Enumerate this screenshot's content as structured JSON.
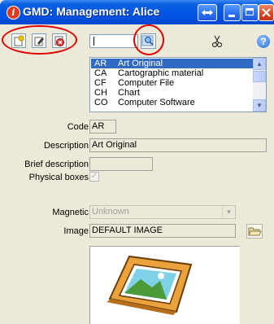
{
  "window": {
    "title": "GMD: Management: Alice",
    "title_icon": "info-icon"
  },
  "toolbar": {
    "search_value": "",
    "help_label": "?"
  },
  "code_list": {
    "items": [
      {
        "code": "AR",
        "description": "Art Original",
        "selected": true
      },
      {
        "code": "CA",
        "description": "Cartographic material",
        "selected": false
      },
      {
        "code": "CF",
        "description": "Computer File",
        "selected": false
      },
      {
        "code": "CH",
        "description": "Chart",
        "selected": false
      },
      {
        "code": "CO",
        "description": "Computer Software",
        "selected": false
      }
    ]
  },
  "form": {
    "code_label": "Code",
    "code_value": "AR",
    "description_label": "Description",
    "description_value": "Art Original",
    "brief_label": "Brief description",
    "brief_value": "",
    "physical_label": "Physical boxes",
    "physical_checked": true,
    "magnetic_label": "Magnetic",
    "magnetic_value": "Unknown",
    "image_label": "Image",
    "image_value": "DEFAULT IMAGE"
  },
  "colors": {
    "titlebar": "#0055e5",
    "selection": "#316ac5",
    "highlight_annotation": "#e00000"
  }
}
